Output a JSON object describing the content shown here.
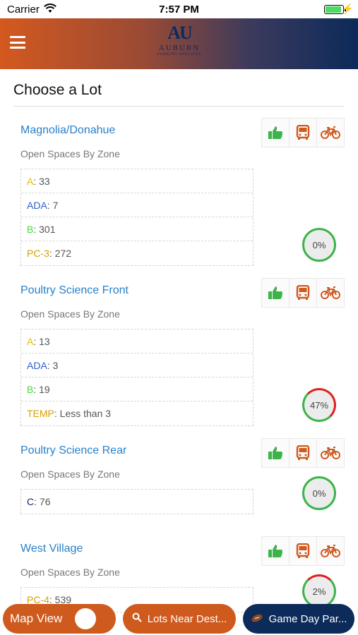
{
  "status_bar": {
    "carrier": "Carrier",
    "time": "7:57 PM",
    "charge_symbol": "⚡"
  },
  "header": {
    "logo_mark": "AU",
    "logo_name": "AUBURN",
    "logo_sub": "PARKING SERVICES"
  },
  "page": {
    "title": "Choose a Lot"
  },
  "lots": [
    {
      "name": "Magnolia/Donahue",
      "subtitle": "Open Spaces By Zone",
      "zones": [
        {
          "code": "A",
          "value": ": 33",
          "color": "#e0c000"
        },
        {
          "code": "ADA",
          "value": ": 7",
          "color": "#2e5fc8"
        },
        {
          "code": "B",
          "value": ": 301",
          "color": "#44dd33"
        },
        {
          "code": "PC-3",
          "value": ": 272",
          "color": "#d8a000"
        }
      ],
      "percent_label": "0%",
      "percent": 0
    },
    {
      "name": "Poultry Science Front",
      "subtitle": "Open Spaces By Zone",
      "zones": [
        {
          "code": "A",
          "value": ": 13",
          "color": "#e0c000"
        },
        {
          "code": "ADA",
          "value": ": 3",
          "color": "#2e5fc8"
        },
        {
          "code": "B",
          "value": ": 19",
          "color": "#44dd33"
        },
        {
          "code": "TEMP",
          "value": ": Less than 3",
          "color": "#d8a000"
        }
      ],
      "percent_label": "47%",
      "percent": 47
    },
    {
      "name": "Poultry Science Rear",
      "subtitle": "Open Spaces By Zone",
      "zones": [
        {
          "code": "C",
          "value": ": 76",
          "color": "#1a2a6c"
        }
      ],
      "percent_label": "0%",
      "percent": 0
    },
    {
      "name": "West Village",
      "subtitle": "Open Spaces By Zone",
      "zones": [
        {
          "code": "PC-4",
          "value": ": 539",
          "color": "#d8a000"
        }
      ],
      "percent_label": "2%",
      "percent": 2
    }
  ],
  "bottom": {
    "map_label": "Map View",
    "lots_label": "Lots Near Dest...",
    "game_label": "Game Day Par..."
  },
  "colors": {
    "accent_orange": "#cf5a1e",
    "navy": "#0c2a5a",
    "link_blue": "#2980c8",
    "thumb_green": "#3cb44b"
  }
}
